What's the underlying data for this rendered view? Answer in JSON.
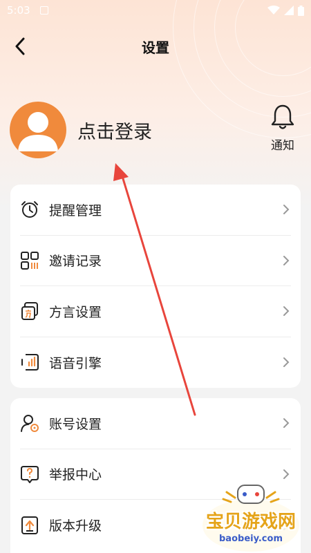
{
  "status_bar": {
    "time": "5:03"
  },
  "header": {
    "title": "设置"
  },
  "profile": {
    "login_label": "点击登录",
    "notify_label": "通知"
  },
  "menu_group_1": [
    {
      "label": "提醒管理",
      "icon": "alarm-clock-icon"
    },
    {
      "label": "邀请记录",
      "icon": "qr-code-icon"
    },
    {
      "label": "方言设置",
      "icon": "dialect-icon"
    },
    {
      "label": "语音引擎",
      "icon": "voice-engine-icon"
    }
  ],
  "menu_group_2": [
    {
      "label": "账号设置",
      "icon": "account-settings-icon"
    },
    {
      "label": "举报中心",
      "icon": "report-icon"
    },
    {
      "label": "版本升级",
      "icon": "upgrade-icon"
    }
  ],
  "watermark": {
    "text": "宝贝游戏网",
    "url": "baobeiy.com"
  },
  "colors": {
    "accent": "#f08a3c",
    "arrow": "#e8453c",
    "watermark": "#e5a41a"
  }
}
